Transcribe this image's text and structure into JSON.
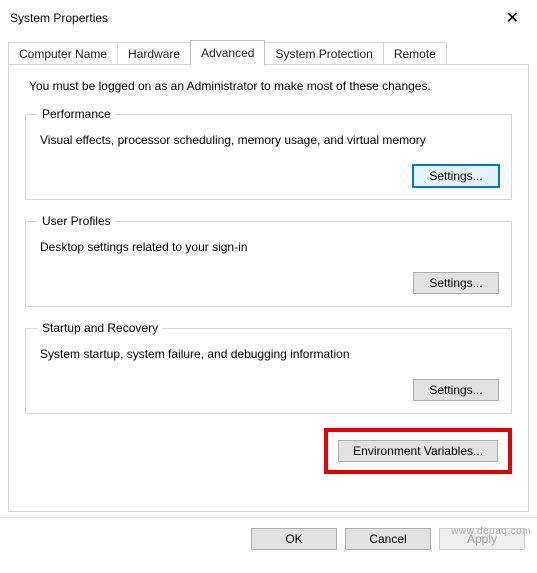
{
  "window": {
    "title": "System Properties",
    "close_glyph": "✕"
  },
  "tabs": {
    "t0": "Computer Name",
    "t1": "Hardware",
    "t2": "Advanced",
    "t3": "System Protection",
    "t4": "Remote"
  },
  "intro": "You must be logged on as an Administrator to make most of these changes.",
  "groups": {
    "performance": {
      "legend": "Performance",
      "desc": "Visual effects, processor scheduling, memory usage, and virtual memory",
      "button": "Settings..."
    },
    "user_profiles": {
      "legend": "User Profiles",
      "desc": "Desktop settings related to your sign-in",
      "button": "Settings..."
    },
    "startup": {
      "legend": "Startup and Recovery",
      "desc": "System startup, system failure, and debugging information",
      "button": "Settings..."
    }
  },
  "env_button": "Environment Variables...",
  "dialog": {
    "ok": "OK",
    "cancel": "Cancel",
    "apply": "Apply"
  },
  "watermark": "www.deuaq.com"
}
